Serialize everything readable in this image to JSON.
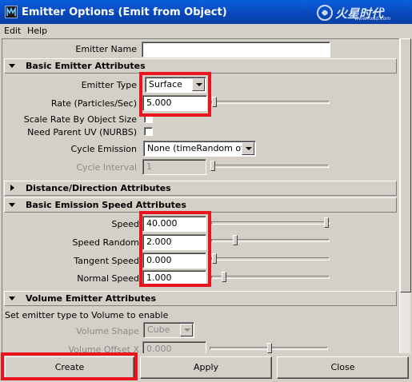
{
  "window": {
    "title": "Emitter Options (Emit from Object)",
    "watermark": "火星时代",
    "watermark_sub": "www.hxsd.com"
  },
  "menu": {
    "items": [
      "Edit",
      "Help"
    ]
  },
  "emitter_name": {
    "label": "Emitter Name",
    "value": ""
  },
  "sections": {
    "basic": {
      "title": "Basic Emitter Attributes",
      "expanded": true
    },
    "distance": {
      "title": "Distance/Direction Attributes",
      "expanded": false
    },
    "speed": {
      "title": "Basic Emission Speed Attributes",
      "expanded": true
    },
    "volume": {
      "title": "Volume Emitter Attributes",
      "expanded": true
    }
  },
  "basic": {
    "emitter_type": {
      "label": "Emitter Type",
      "value": "Surface"
    },
    "rate": {
      "label": "Rate (Particles/Sec)",
      "value": "5.000",
      "slider_fraction": 0.02
    },
    "scale_rate": {
      "label": "Scale Rate By Object Size",
      "checked": false
    },
    "need_parent_uv": {
      "label": "Need Parent UV (NURBS)",
      "checked": false
    },
    "cycle_emission": {
      "label": "Cycle Emission",
      "value": "None (timeRandom off)"
    },
    "cycle_interval": {
      "label": "Cycle Interval",
      "value": "1",
      "enabled": false,
      "slider_fraction": 0.0
    }
  },
  "speed": {
    "speed": {
      "label": "Speed",
      "value": "40.000",
      "slider_fraction": 1.0
    },
    "speed_random": {
      "label": "Speed Random",
      "value": "2.000",
      "slider_fraction": 0.18
    },
    "tangent_speed": {
      "label": "Tangent Speed",
      "value": "0.000",
      "slider_fraction": 0.0
    },
    "normal_speed": {
      "label": "Normal Speed",
      "value": "1.000",
      "slider_fraction": 0.09
    }
  },
  "volume": {
    "note": "Set emitter type to Volume to enable",
    "volume_shape": {
      "label": "Volume Shape",
      "value": "Cube",
      "enabled": false
    },
    "volume_offset_x": {
      "label": "Volume Offset X",
      "value": "0.000",
      "enabled": false,
      "slider_fraction": 0.5
    }
  },
  "buttons": {
    "create": "Create",
    "apply": "Apply",
    "close": "Close"
  },
  "colors": {
    "highlight": "#e8141e",
    "titlebar": "#0a4fc8",
    "panel": "#d4d0c8"
  }
}
